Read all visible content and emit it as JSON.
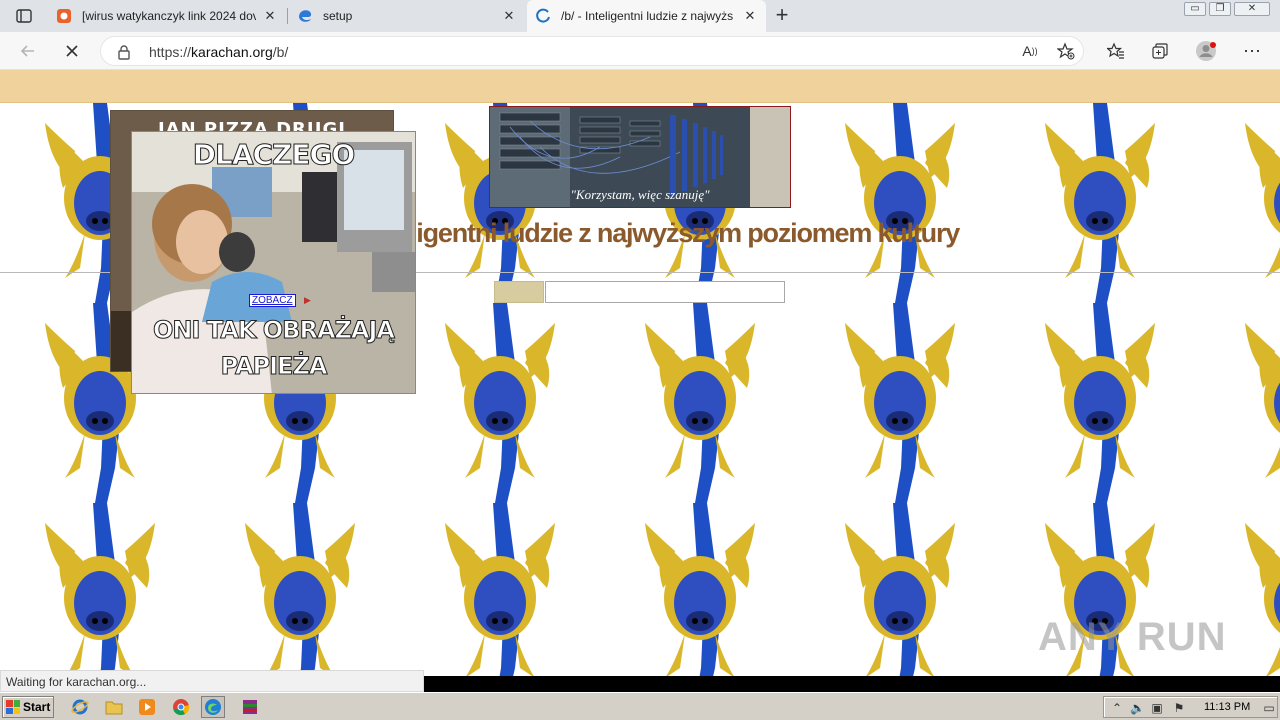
{
  "browser": {
    "tabs": [
      {
        "title": "[wirus watykanczyk link 2024 dov",
        "close": "✕"
      },
      {
        "title": "setup",
        "close": "✕"
      },
      {
        "title": "/b/ - Inteligentni ludzie z najwyżs",
        "close": "✕"
      }
    ],
    "new_tab": "+",
    "window_controls": [
      "▭",
      "❐",
      "✕"
    ],
    "url_prefix": "https://",
    "url_host": "karachan.org",
    "url_path": "/b/",
    "status": "Waiting for karachan.org..."
  },
  "page": {
    "banner_caption": "\"Korzystam, więc szanuję\"",
    "board_title": "ligentni ludzie z najwyższym poziomem kultury",
    "ad_back_text": "JAN PIZZA DRUGI",
    "ad_front_top": "DLACZEGO",
    "ad_front_bottom_1": "ONI TAK OBRAŻAJĄ",
    "ad_front_bottom_2": "PAPIEŻA",
    "ad_link": "ZOBACZ",
    "watermark": "ANY RUN"
  },
  "taskbar": {
    "start_label": "Start",
    "clock": "11:13 PM"
  },
  "colors": {
    "topbar": "#f0d29c",
    "title": "#8a5a2c",
    "pig_yellow": "#d9b62a",
    "pig_blue": "#2f4fc0"
  },
  "icons": [
    "tab-actions-icon",
    "brave-icon",
    "edge-icon",
    "loading-icon",
    "back-icon",
    "stop-icon",
    "lock-icon",
    "read-aloud-icon",
    "favorite-add-icon",
    "favorites-icon",
    "collections-icon",
    "profile-icon",
    "more-icon"
  ]
}
